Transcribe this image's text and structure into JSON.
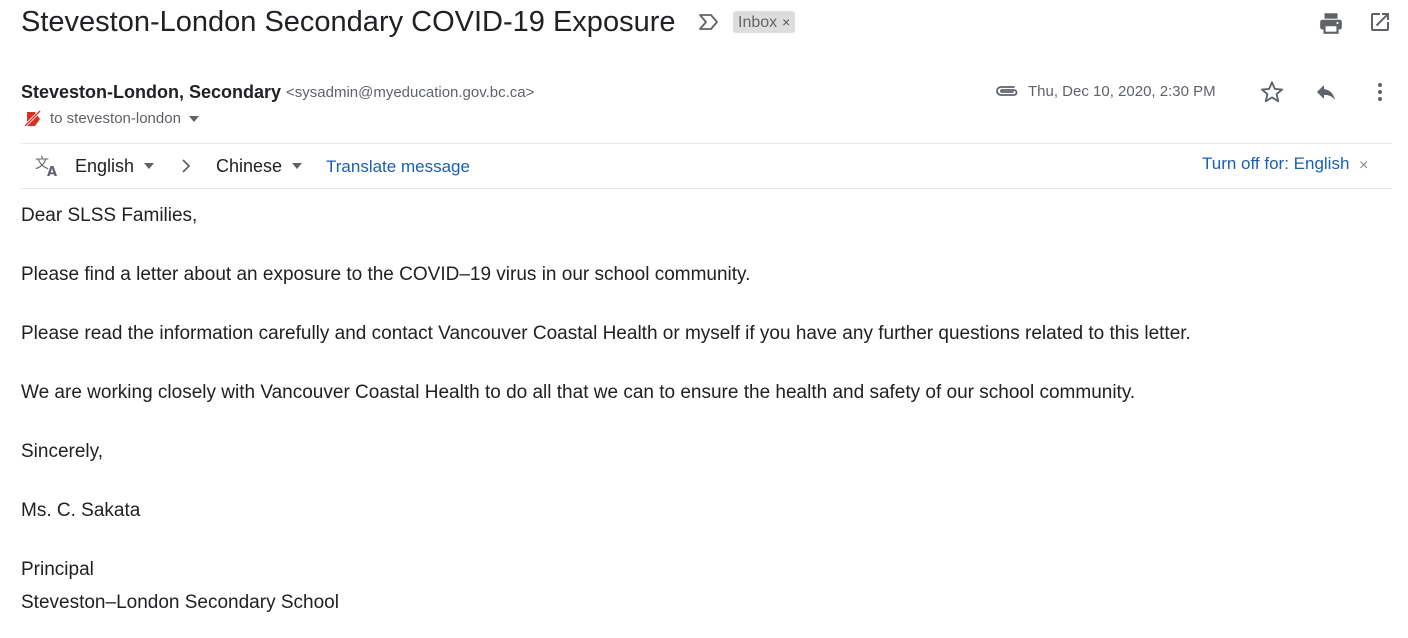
{
  "header": {
    "subject": "Steveston-London Secondary COVID-19 Exposure",
    "label": "Inbox",
    "label_remove": "×",
    "icons": {
      "important": "importance-marker-icon",
      "print": "print-icon",
      "popout": "open-in-new-window-icon"
    }
  },
  "sender": {
    "name": "Steveston-London, Secondary",
    "email": "<sysadmin@myeducation.gov.bc.ca>",
    "to": "to steveston-london",
    "icons": {
      "unverified": "unverified-sender-icon",
      "details": "chevron-down-icon"
    }
  },
  "meta": {
    "date": "Thu, Dec 10, 2020, 2:30 PM",
    "icons": {
      "attachment": "attachment-icon",
      "star": "star-icon",
      "reply": "reply-icon",
      "more": "more-vert-icon"
    }
  },
  "translate": {
    "from_lang": "English",
    "to_lang": "Chinese",
    "translate_label": "Translate message",
    "turn_off_label": "Turn off for: English",
    "close": "×"
  },
  "body": {
    "paragraphs": [
      "Dear SLSS Families,",
      "Please find a letter about an exposure to the COVID–19 virus in our school community.",
      "Please read the information carefully and contact Vancouver Coastal Health or myself if you have any further questions related to this letter.",
      "We are working closely with Vancouver Coastal Health to do all that we can to ensure the health and safety of our school community.",
      "Sincerely,",
      "Ms. C. Sakata",
      "Principal",
      "Steveston–London Secondary School"
    ]
  },
  "colors": {
    "link": "#1a5fb4",
    "muted": "#5f6368",
    "text": "#202124",
    "chip": "#dddddd",
    "unverified": "#d93025"
  }
}
